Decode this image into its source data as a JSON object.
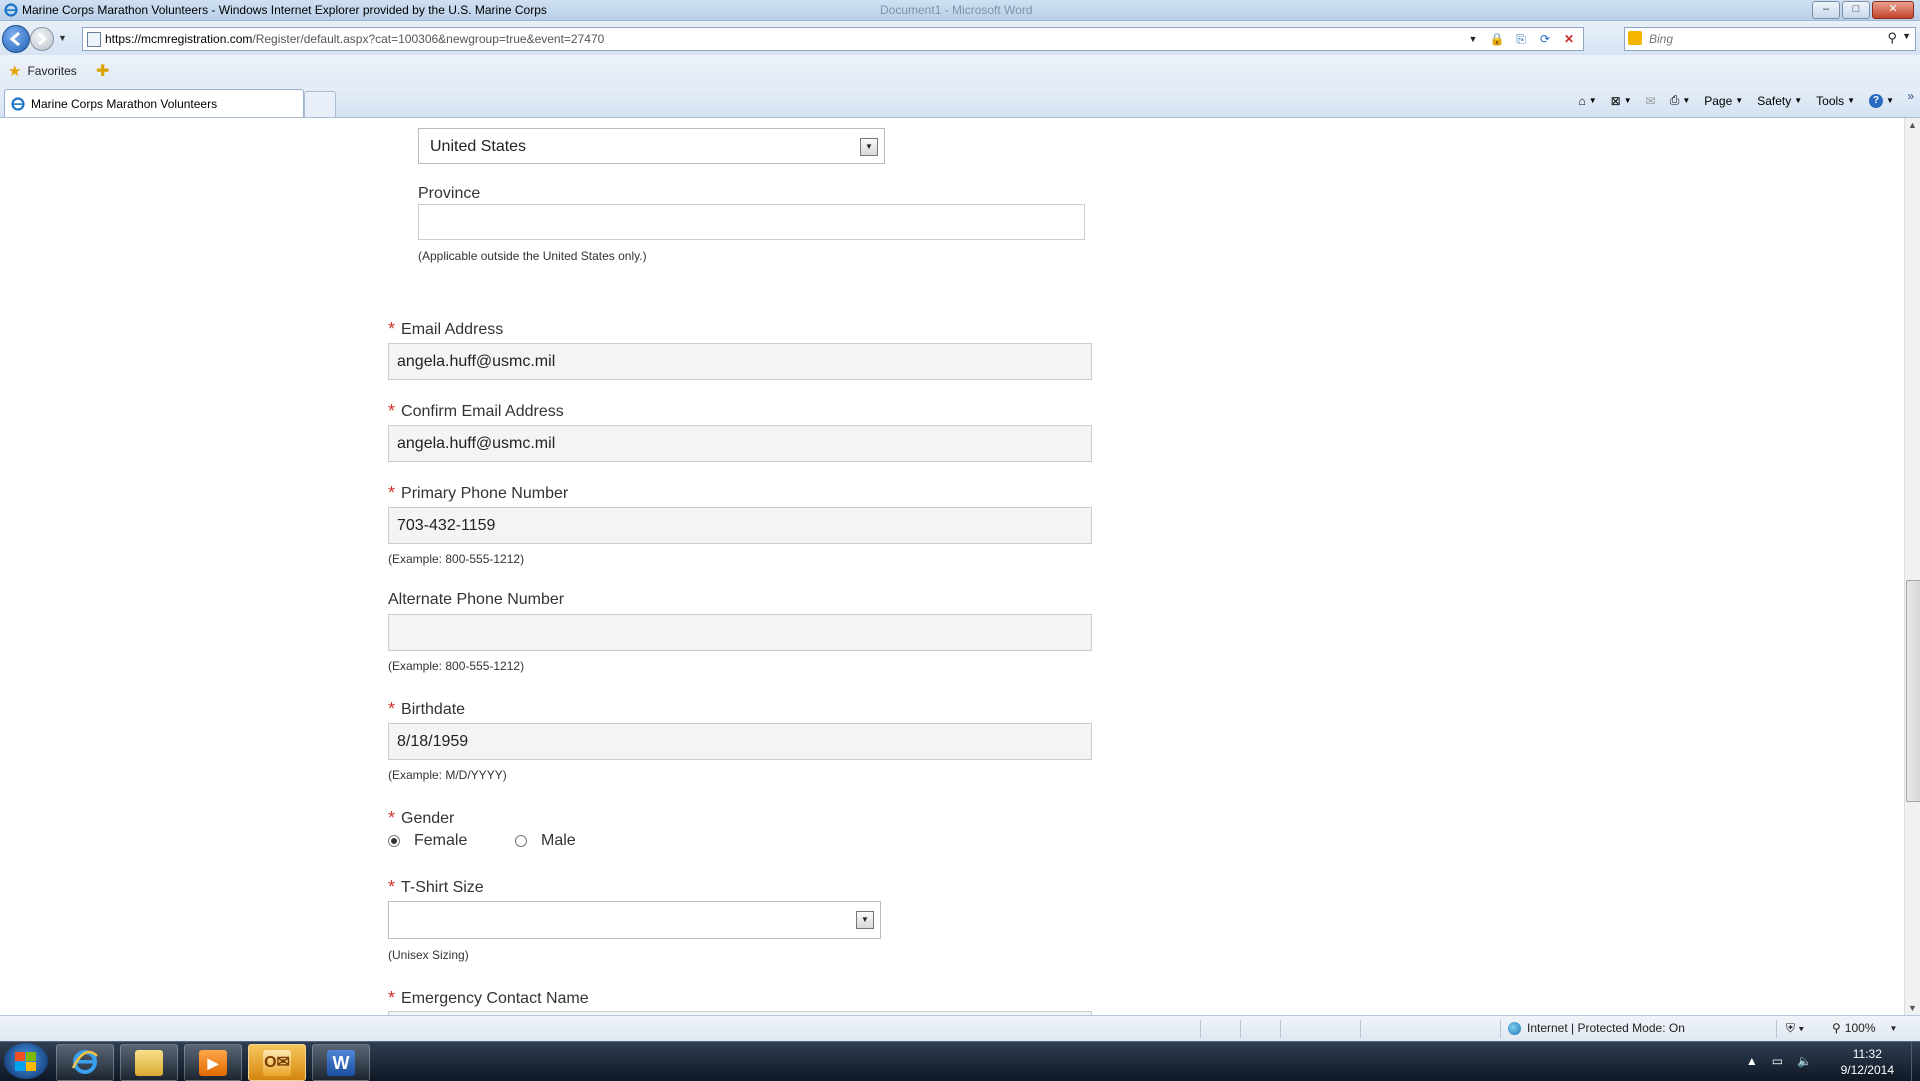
{
  "window": {
    "title": "Marine Corps Marathon Volunteers - Windows Internet Explorer provided by the U.S. Marine Corps",
    "ghost_title": "Document1 - Microsoft Word",
    "min_symbol": "–",
    "max_symbol": "□",
    "close_symbol": "✕"
  },
  "address_bar": {
    "url_host": "https://mcmregistration.com",
    "url_path": "/Register/default.aspx?cat=100306&newgroup=true&event=27470",
    "search_placeholder": "Bing"
  },
  "favorites_bar": {
    "favorites_label": "Favorites"
  },
  "tabs": [
    {
      "label": "Marine Corps Marathon Volunteers"
    }
  ],
  "command_bar": {
    "page_label": "Page",
    "safety_label": "Safety",
    "tools_label": "Tools"
  },
  "form": {
    "country": {
      "value": "United States"
    },
    "province": {
      "label": "Province",
      "value": "",
      "hint": "(Applicable outside the United States only.)"
    },
    "email": {
      "label": "Email Address",
      "value": "angela.huff@usmc.mil",
      "required": true
    },
    "confirm_email": {
      "label": "Confirm Email Address",
      "value": "angela.huff@usmc.mil",
      "required": true
    },
    "primary_phone": {
      "label": "Primary Phone Number",
      "value": "703-432-1159",
      "hint": "(Example: 800-555-1212)",
      "required": true
    },
    "alternate_phone": {
      "label": "Alternate Phone Number",
      "value": "",
      "hint": "(Example: 800-555-1212)"
    },
    "birthdate": {
      "label": "Birthdate",
      "value": "8/18/1959",
      "hint": "(Example: M/D/YYYY)",
      "required": true
    },
    "gender": {
      "label": "Gender",
      "options": [
        "Female",
        "Male"
      ],
      "selected": "Female",
      "required": true
    },
    "tshirt": {
      "label": "T-Shirt Size",
      "value": "",
      "hint": "(Unisex Sizing)",
      "required": true
    },
    "emergency_contact": {
      "label": "Emergency Contact Name",
      "required": true
    },
    "required_marker": "*"
  },
  "status_bar": {
    "zone": "Internet | Protected Mode: On",
    "zoom": "100%"
  },
  "taskbar": {
    "clock_time": "11:32",
    "clock_date": "9/12/2014",
    "items": [
      "internet-explorer",
      "file-explorer",
      "media-player",
      "outlook",
      "word"
    ]
  },
  "colors": {
    "required": "#d0332b",
    "field_bg": "#f4f4f4",
    "outlook_active": "#e8a62a"
  }
}
